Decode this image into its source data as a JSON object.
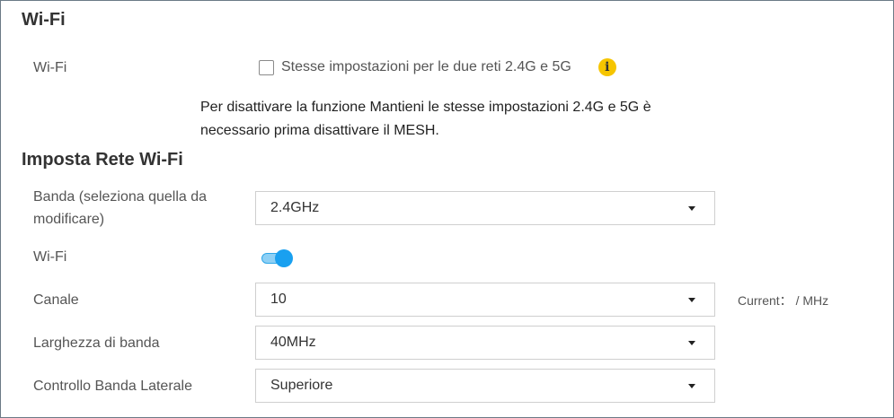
{
  "wifi_section": {
    "title": "Wi-Fi",
    "wifi_label": "Wi-Fi",
    "same_settings_label": "Stesse impostazioni per le due reti 2.4G e 5G",
    "same_settings_checked": false,
    "info_icon": "info-icon",
    "info_glyph": "i",
    "notice_line1": "Per disattivare la funzione Mantieni le stesse impostazioni 2.4G e 5G è",
    "notice_line2": "necessario prima disattivare il MESH."
  },
  "network_section": {
    "title": "Imposta Rete Wi-Fi",
    "band": {
      "label_line1": "Banda (seleziona quella da",
      "label_line2": "modificare)",
      "value": "2.4GHz"
    },
    "wifi_toggle": {
      "label": "Wi-Fi",
      "on": true
    },
    "channel": {
      "label": "Canale",
      "value": "10",
      "current_text": "Current： / MHz"
    },
    "bandwidth": {
      "label": "Larghezza di banda",
      "value": "40MHz"
    },
    "sideband": {
      "label": "Controllo Banda Laterale",
      "value": "Superiore"
    }
  },
  "colors": {
    "accent": "#19a0f0",
    "info": "#f6c500"
  }
}
